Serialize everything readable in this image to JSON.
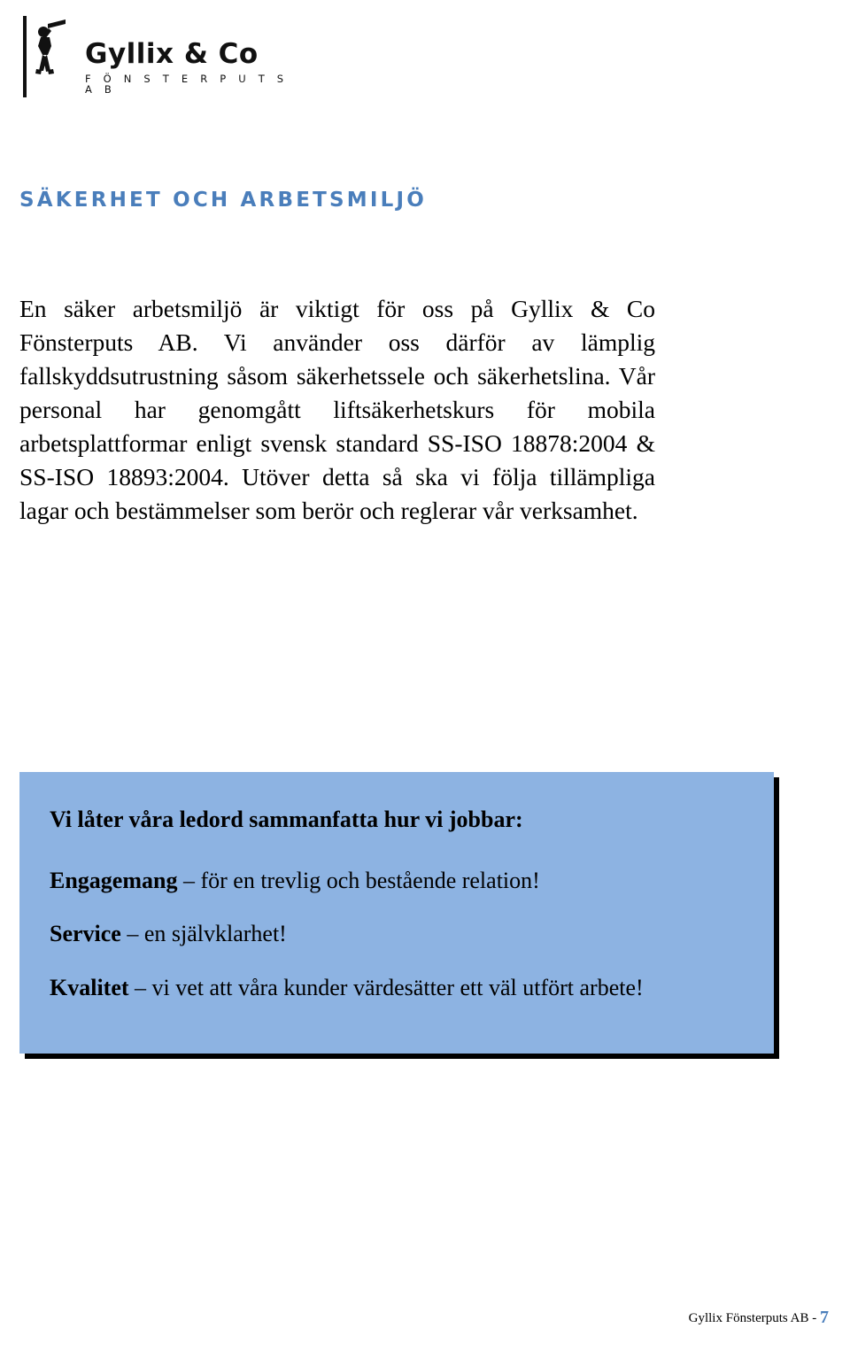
{
  "logo": {
    "icon": "window-cleaner-figure-icon",
    "company_name": "Gyllix & Co",
    "tagline": "F Ö N S T E R P U T S   A B"
  },
  "section": {
    "heading": "SÄKERHET OCH ARBETSMILJÖ",
    "heading_color": "#4a7ebb"
  },
  "body": {
    "paragraph": "En säker arbetsmiljö är viktigt för oss på Gyllix & Co Fönsterputs AB. Vi använder oss därför av lämplig fallskyddsutrustning såsom säkerhetssele och säkerhetslina. Vår personal har genomgått liftsäkerhetskurs för mobila arbetsplattformar enligt svensk standard SS-ISO 18878:2004 & SS-ISO 18893:2004. Utöver detta så ska vi följa tillämpliga lagar och bestämmelser som berör och reglerar vår verksamhet."
  },
  "ledord": {
    "background_color": "#8db3e2",
    "title": "Vi låter våra ledord sammanfatta hur vi jobbar:",
    "items": [
      {
        "term": "Engagemang",
        "rest": " – för en trevlig och bestående relation!"
      },
      {
        "term": "Service",
        "rest": " – en självklarhet!"
      },
      {
        "term": "Kvalitet",
        "rest": " – vi vet att våra kunder värdesätter ett väl utfört arbete!"
      }
    ]
  },
  "footer": {
    "text": "Gyllix Fönsterputs AB  -  ",
    "page_number": "7",
    "page_number_color": "#4a7ebb"
  }
}
